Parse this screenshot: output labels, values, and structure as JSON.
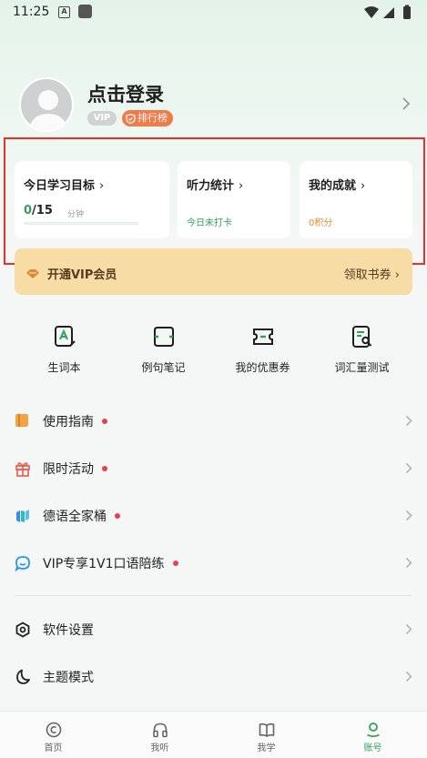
{
  "status_bar": {
    "time": "11:25",
    "a_icon": "A"
  },
  "profile": {
    "login_text": "点击登录",
    "vip_badge": "VIP",
    "rank_badge": "排行榜"
  },
  "stats": {
    "goal": {
      "title": "今日学习目标",
      "current": "0",
      "target": "/15",
      "unit": "分钟",
      "progress": 0
    },
    "listening": {
      "title": "听力统计",
      "status": "今日未打卡"
    },
    "achievement": {
      "title": "我的成就",
      "points": "0积分"
    }
  },
  "vip_banner": {
    "left_label": "开通VIP会员",
    "right_label": "领取书券"
  },
  "tools": [
    {
      "label": "生词本",
      "icon": "vocab-book-icon"
    },
    {
      "label": "例句笔记",
      "icon": "sentence-note-icon"
    },
    {
      "label": "我的优惠券",
      "icon": "coupon-icon"
    },
    {
      "label": "词汇量测试",
      "icon": "vocab-test-icon"
    }
  ],
  "menu": [
    {
      "label": "使用指南",
      "icon": "guide-book-icon",
      "dot": true
    },
    {
      "label": "限时活动",
      "icon": "gift-icon",
      "dot": true
    },
    {
      "label": "德语全家桶",
      "icon": "app-bundle-icon",
      "dot": true
    },
    {
      "label": "VIP专享1V1口语陪练",
      "icon": "chat-icon",
      "dot": true
    },
    {
      "label": "软件设置",
      "icon": "settings-icon",
      "dot": false
    },
    {
      "label": "主题模式",
      "icon": "moon-icon",
      "dot": false
    }
  ],
  "bottom_nav": [
    {
      "label": "首页",
      "icon": "home-icon"
    },
    {
      "label": "我听",
      "icon": "headphones-icon"
    },
    {
      "label": "我学",
      "icon": "book-icon"
    },
    {
      "label": "账号",
      "icon": "account-icon",
      "active": true
    }
  ],
  "colors": {
    "accent_green": "#2fa15a",
    "orange": "#f07a48",
    "vip_gold": "#f7dca5",
    "highlight_red": "#e8302d",
    "dot_red": "#ea3f4a"
  }
}
